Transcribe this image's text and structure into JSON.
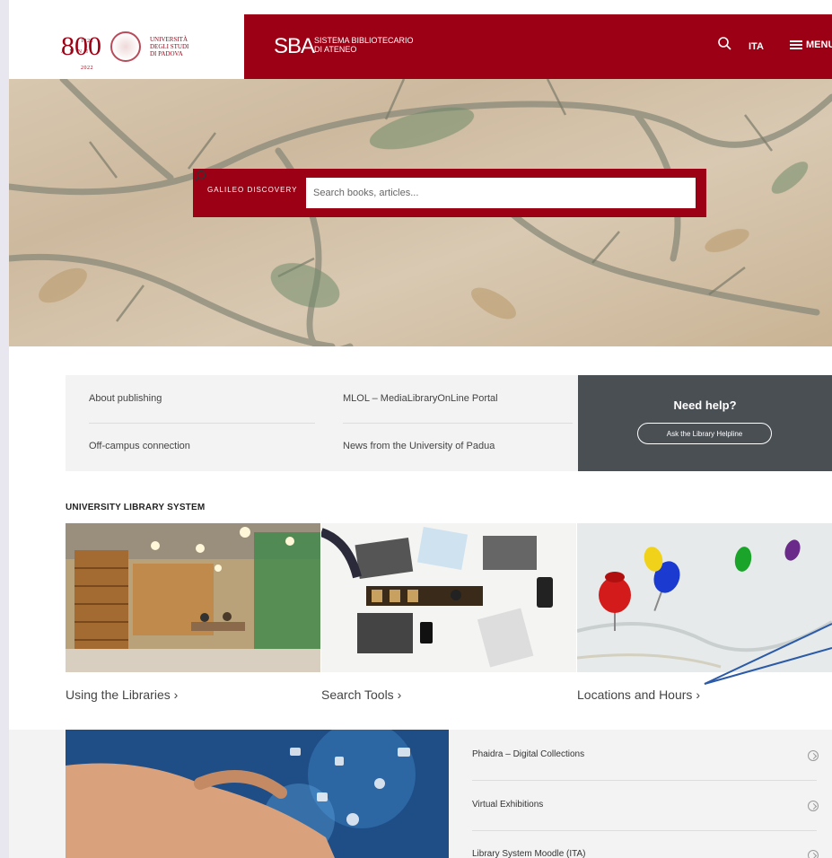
{
  "header": {
    "logo_800": "800",
    "logo_years": "1222 2022",
    "logo_anni": "ANNI",
    "university_name": [
      "UNIVERSITÀ",
      "DEGLI STUDI",
      "DI PADOVA"
    ],
    "sba_logo": "SBA",
    "sba_text": [
      "SISTEMA BIBLIOTECARIO",
      "DI ATENEO"
    ],
    "language": "ITA",
    "menu_label": "MENU"
  },
  "search": {
    "logo_text": "GALILEO DISCOVERY",
    "placeholder": "Search books, articles..."
  },
  "quick_links": {
    "left": [
      "About publishing",
      "Off-campus connection"
    ],
    "middle": [
      "MLOL – MediaLibraryOnLine Portal",
      "News from the University of Padua"
    ]
  },
  "help": {
    "title": "Need help?",
    "button": "Ask the Library Helpline"
  },
  "section": {
    "title": "UNIVERSITY LIBRARY SYSTEM",
    "cards": [
      {
        "label": "Using the Libraries"
      },
      {
        "label": "Search Tools"
      },
      {
        "label": "Locations and Hours"
      }
    ]
  },
  "digital_links": [
    "Phaidra – Digital Collections",
    "Virtual Exhibitions",
    "Library System Moodle (ITA)"
  ],
  "colors": {
    "brand_red": "#9b0014",
    "help_bg": "#4a4f54",
    "annotation": "#2a5aa8"
  }
}
